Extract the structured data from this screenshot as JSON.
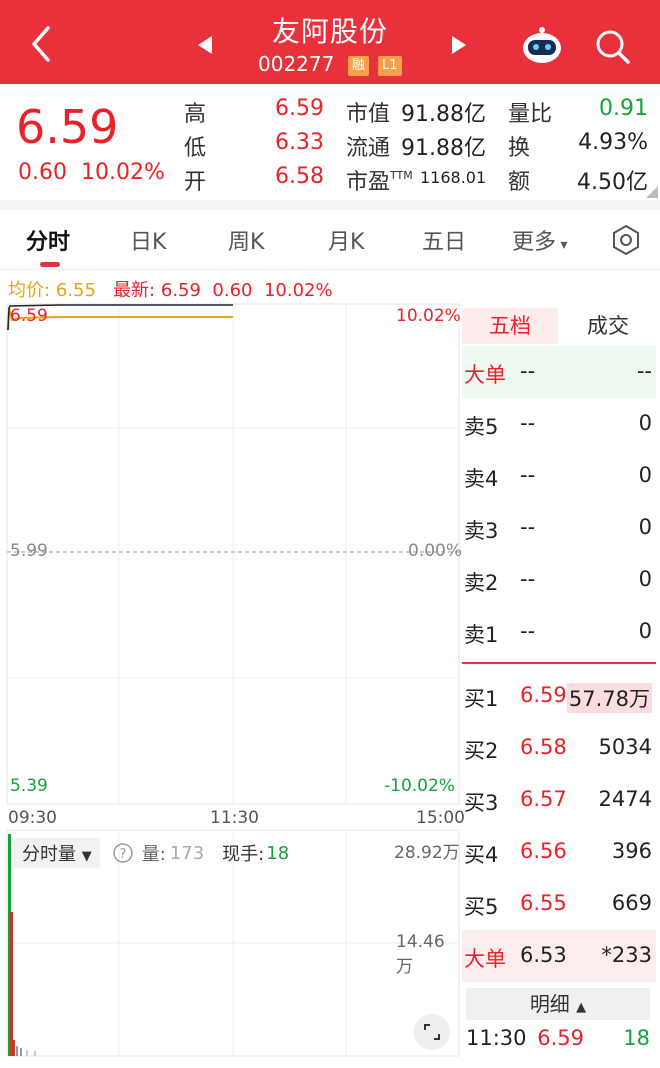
{
  "header": {
    "title": "友阿股份",
    "code": "002277",
    "badge_margin": "融",
    "badge_level": "L1"
  },
  "quote": {
    "price": "6.59",
    "change": "0.60",
    "change_pct": "10.02%",
    "rows": [
      {
        "label": "高",
        "value": "6.59"
      },
      {
        "label": "低",
        "value": "6.33"
      },
      {
        "label": "开",
        "value": "6.58"
      }
    ],
    "market_cap_label": "市值",
    "market_cap": "91.88亿",
    "float_label": "流通",
    "float_value": "91.88亿",
    "pe_label": "市盈",
    "pe_sup": "TTM",
    "pe_value": "1168.01",
    "vol_ratio_label": "量比",
    "vol_ratio": "0.91",
    "turnover_label": "换",
    "turnover": "4.93%",
    "amount_label": "额",
    "amount": "4.50亿"
  },
  "tabs": [
    "分时",
    "日K",
    "周K",
    "月K",
    "五日",
    "更多"
  ],
  "info_line": {
    "avg_label": "均价:",
    "avg_value": "6.55",
    "latest_label": "最新:",
    "latest_value": "6.59",
    "chg": "0.60",
    "chg_pct": "10.02%"
  },
  "chart": {
    "y_top": "6.59",
    "y_mid": "5.99",
    "y_bot": "5.39",
    "pct_top": "10.02%",
    "pct_mid": "0.00%",
    "pct_bot": "-10.02%",
    "x_start": "09:30",
    "x_mid": "11:30",
    "x_end": "15:00",
    "vol_dropdown": "分时量",
    "vol_label": "量:",
    "vol_value": "173",
    "now_label": "现手:",
    "now_value": "18",
    "vol_max": "28.92万",
    "vol_half": "14.46万"
  },
  "orderbook": {
    "tab_active": "五档",
    "tab_other": "成交",
    "big_top": {
      "label": "大单",
      "price": "--",
      "qty": "--"
    },
    "asks": [
      {
        "label": "卖5",
        "price": "--",
        "qty": "0"
      },
      {
        "label": "卖4",
        "price": "--",
        "qty": "0"
      },
      {
        "label": "卖3",
        "price": "--",
        "qty": "0"
      },
      {
        "label": "卖2",
        "price": "--",
        "qty": "0"
      },
      {
        "label": "卖1",
        "price": "--",
        "qty": "0"
      }
    ],
    "bids": [
      {
        "label": "买1",
        "price": "6.59",
        "qty": "57.78万"
      },
      {
        "label": "买2",
        "price": "6.58",
        "qty": "5034"
      },
      {
        "label": "买3",
        "price": "6.57",
        "qty": "2474"
      },
      {
        "label": "买4",
        "price": "6.56",
        "qty": "396"
      },
      {
        "label": "买5",
        "price": "6.55",
        "qty": "669"
      }
    ],
    "big_bottom": {
      "label": "大单",
      "price": "6.53",
      "qty": "*233"
    },
    "detail_label": "明细",
    "tick": {
      "time": "11:30",
      "price": "6.59",
      "qty": "18"
    }
  },
  "colors": {
    "header_bg": "#e8313a",
    "up": "#e8222a",
    "down": "#12a33b",
    "avg": "#e8a317"
  }
}
